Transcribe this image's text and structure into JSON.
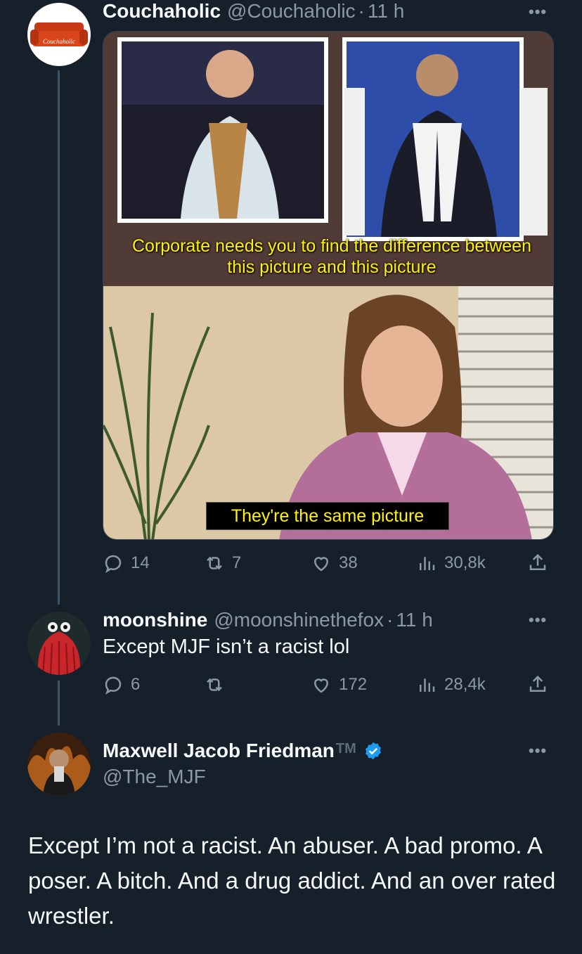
{
  "tweet1": {
    "display_name": "Couchaholic",
    "handle": "@Couchaholic",
    "separator": "·",
    "time": "11 h",
    "avatar_text": "Couchaholic",
    "meme": {
      "caption_top": "Corporate needs you to find the difference between this picture and this picture",
      "caption_bottom": "They're the same picture"
    },
    "stats": {
      "replies": "14",
      "retweets": "7",
      "likes": "38",
      "views": "30,8k"
    }
  },
  "tweet2": {
    "display_name": "moonshine",
    "handle": "@moonshinethefox",
    "separator": "·",
    "time": "11 h",
    "text": "Except MJF isn’t a racist lol",
    "stats": {
      "replies": "6",
      "retweets": "",
      "likes": "172",
      "views": "28,4k"
    }
  },
  "tweet3": {
    "display_name": "Maxwell Jacob Friedman",
    "tm": "TM",
    "handle": "@The_MJF",
    "text": "Except I’m not a racist. An abuser. A bad promo. A poser. A bitch. And a drug addict. And an over rated wrestler."
  },
  "icons": {
    "more": "more-icon",
    "reply": "reply-icon",
    "retweet": "retweet-icon",
    "like": "heart-icon",
    "views": "views-icon",
    "share": "share-icon",
    "verified": "verified-badge-icon"
  },
  "colors": {
    "background": "#15202b",
    "muted": "#8b98a5",
    "verified": "#1d9bf0",
    "caption": "#fff20a"
  }
}
